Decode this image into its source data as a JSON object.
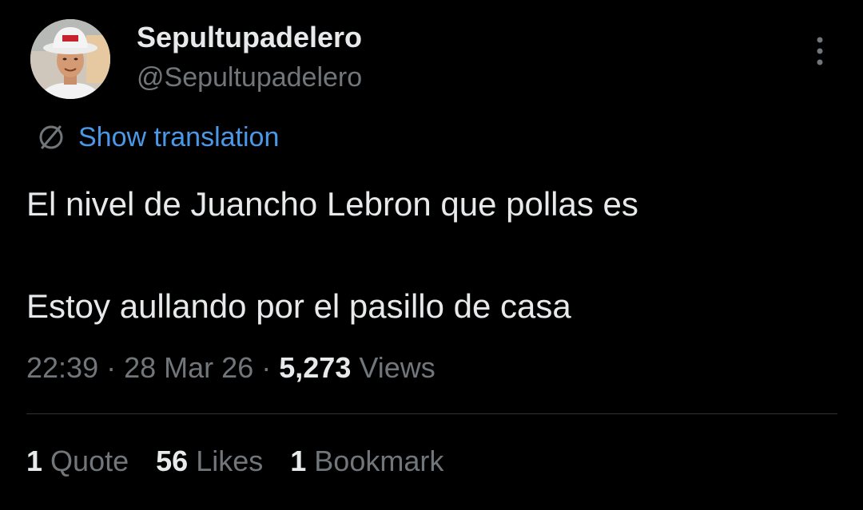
{
  "tweet": {
    "author": {
      "display_name": "Sepultupadelero",
      "handle": "@Sepultupadelero",
      "avatar_icon": "user-avatar"
    },
    "more_icon": "vertical-ellipsis-icon",
    "translation": {
      "label": "Show translation",
      "icon": "translate-globe-icon",
      "color": "#4a99e9"
    },
    "text_lines": [
      "El nivel de Juancho Lebron que pollas es",
      "Estoy aullando por el pasillo de casa"
    ],
    "time": "22:39",
    "separator": "·",
    "date": "28 Mar 26",
    "views_count": "5,273",
    "views_label": "Views",
    "stats": [
      {
        "count": "1",
        "label": "Quote"
      },
      {
        "count": "56",
        "label": "Likes"
      },
      {
        "count": "1",
        "label": "Bookmark"
      }
    ]
  },
  "colors": {
    "background": "#000000",
    "primary_text": "#e7e9ea",
    "secondary_text": "#71767b",
    "divider": "#2f3336"
  }
}
